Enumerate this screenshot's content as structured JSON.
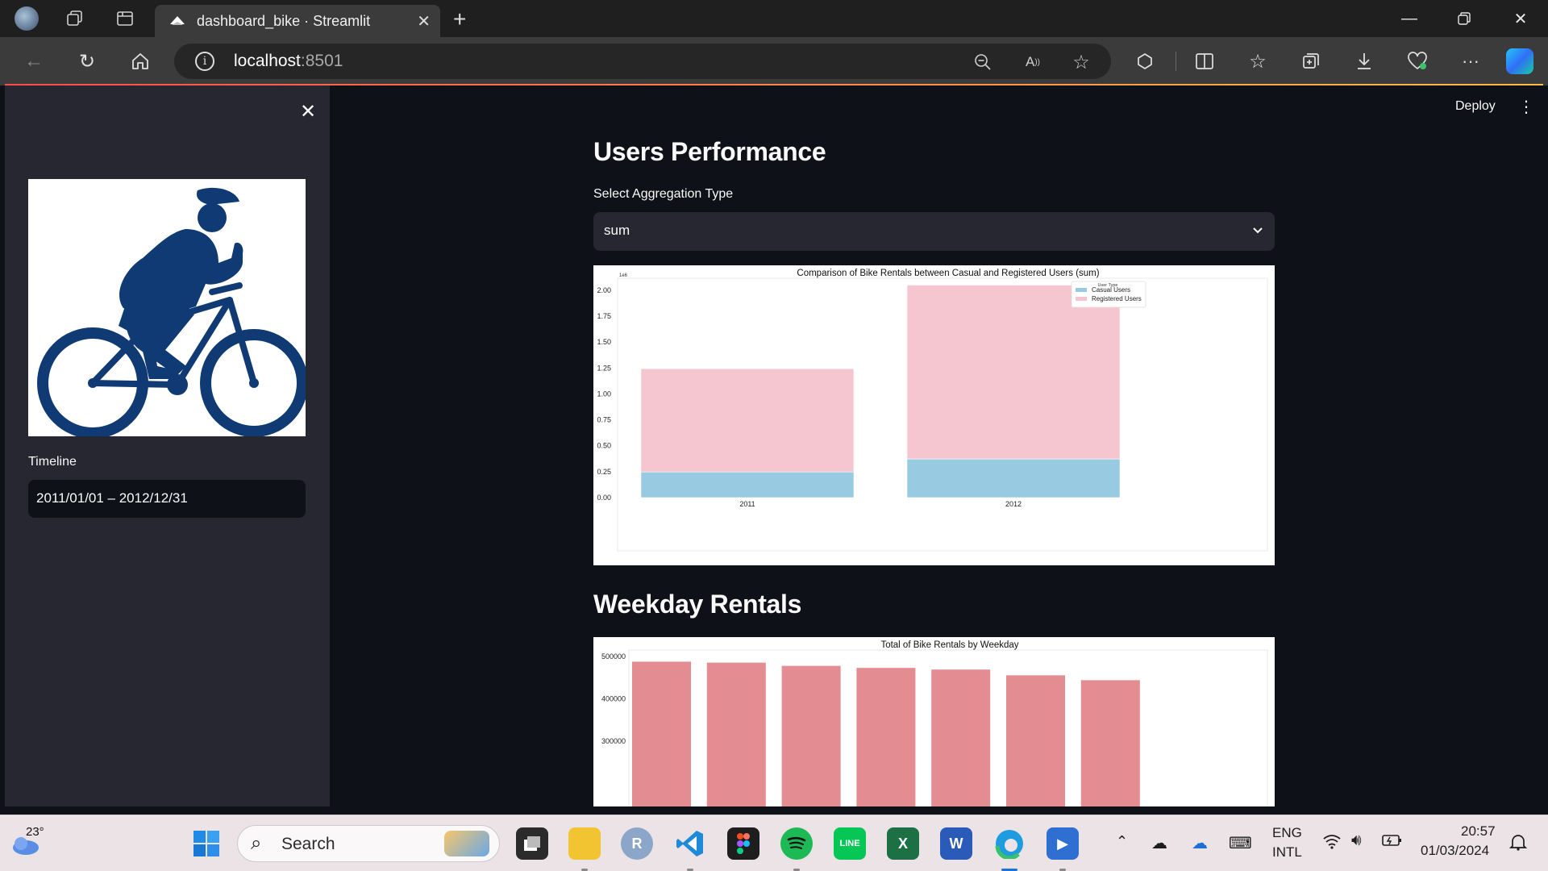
{
  "browser": {
    "tab_title": "dashboard_bike · Streamlit",
    "url_host": "localhost",
    "url_port": ":8501"
  },
  "streamlit": {
    "deploy_label": "Deploy",
    "sidebar": {
      "timeline_label": "Timeline",
      "date_range": "2011/01/01 – 2012/12/31"
    },
    "section1_title": "Users Performance",
    "agg_label": "Select Aggregation Type",
    "agg_value": "sum",
    "section2_title": "Weekday Rentals"
  },
  "chart_data": [
    {
      "type": "bar",
      "title": "Comparison of Bike Rentals between Casual and Registered Users (sum)",
      "categories": [
        "2011",
        "2012"
      ],
      "stacked": true,
      "series": [
        {
          "name": "Casual Users",
          "values": [
            247252,
            372765
          ],
          "color": "#98cae1"
        },
        {
          "name": "Registered Users",
          "values": [
            995851,
            1676811
          ],
          "color": "#f5c6cf"
        }
      ],
      "ylim": [
        0,
        2100000
      ],
      "y_ticks": [
        "0.00",
        "0.25",
        "0.50",
        "0.75",
        "1.00",
        "1.25",
        "1.50",
        "1.75",
        "2.00"
      ],
      "y_offset_label": "1e6",
      "legend_title": "User Type",
      "legend_position": "top-right"
    },
    {
      "type": "bar",
      "title": "Total of Bike Rentals by Weekday",
      "values": [
        487790,
        485395,
        477807,
        473048,
        469109,
        455503,
        444027
      ],
      "color": "#e38c91",
      "ylim": [
        180000,
        510000
      ],
      "y_ticks": [
        "300000",
        "400000",
        "500000"
      ]
    }
  ],
  "taskbar": {
    "weather_temp": "23°",
    "search_placeholder": "Search",
    "lang_line1": "ENG",
    "lang_line2": "INTL",
    "time": "20:57",
    "date": "01/03/2024"
  }
}
